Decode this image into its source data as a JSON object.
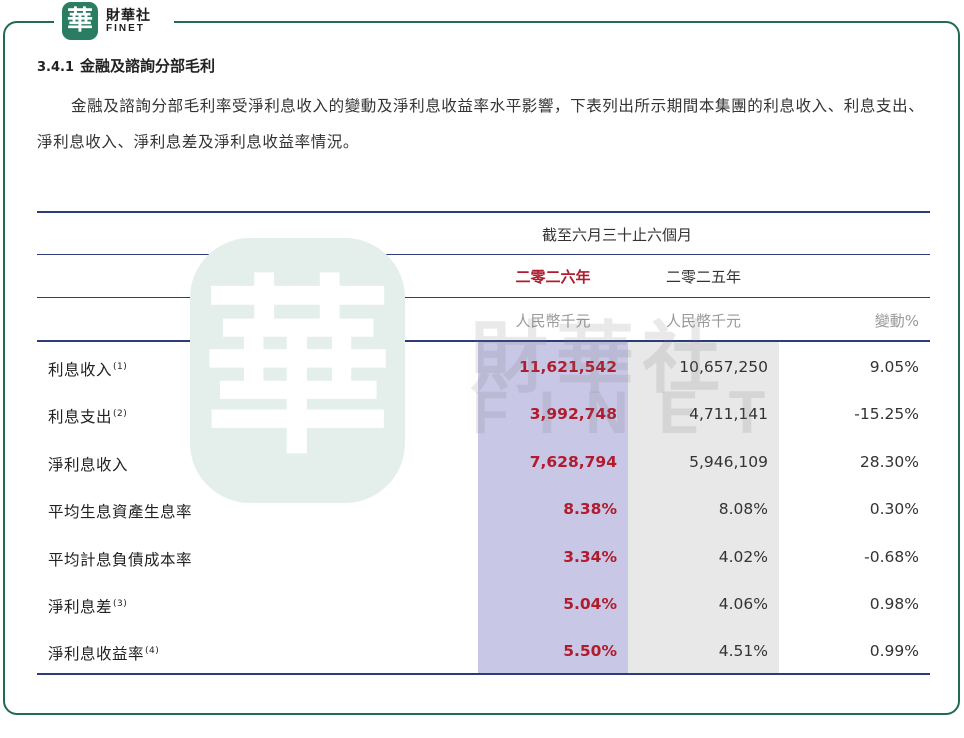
{
  "brand": {
    "seal_char": "華",
    "name_cn": "財華社",
    "name_en": "FINET"
  },
  "section": {
    "number": "3.4.1",
    "title": "金融及諮詢分部毛利"
  },
  "paragraph": "金融及諮詢分部毛利率受淨利息收入的變動及淨利息收益率水平影響，下表列出所示期間本集團的利息收入、利息支出、淨利息收入、淨利息差及淨利息收益率情況。",
  "table": {
    "period_header": "截至六月三十止六個月",
    "year_2026": "二零二六年",
    "year_2025": "二零二五年",
    "unit_2026": "人民幣千元",
    "unit_2025": "人民幣千元",
    "change_header": "變動%",
    "rows": [
      {
        "label": "利息收入",
        "note": "(1)",
        "v2026": "11,621,542",
        "v2025": "10,657,250",
        "change": "9.05%"
      },
      {
        "label": "利息支出",
        "note": "(2)",
        "v2026": "3,992,748",
        "v2025": "4,711,141",
        "change": "-15.25%"
      },
      {
        "label": "淨利息收入",
        "note": "",
        "v2026": "7,628,794",
        "v2025": "5,946,109",
        "change": "28.30%"
      },
      {
        "label": "平均生息資產生息率",
        "note": "",
        "v2026": "8.38%",
        "v2025": "8.08%",
        "change": "0.30%"
      },
      {
        "label": "平均計息負債成本率",
        "note": "",
        "v2026": "3.34%",
        "v2025": "4.02%",
        "change": "-0.68%"
      },
      {
        "label": "淨利息差",
        "note": "(3)",
        "v2026": "5.04%",
        "v2025": "4.06%",
        "change": "0.98%"
      },
      {
        "label": "淨利息收益率",
        "note": "(4)",
        "v2026": "5.50%",
        "v2025": "4.51%",
        "change": "0.99%"
      }
    ]
  },
  "watermark": {
    "seal_char": "華",
    "text_cn": "財華社",
    "text_en": "FINET"
  },
  "colors": {
    "frame": "#1f6b55",
    "accent_red": "#b01c2e",
    "rule": "#2e3a7a",
    "highlight_col": "#c9c7e6",
    "grey_col": "#e8e8e8"
  }
}
